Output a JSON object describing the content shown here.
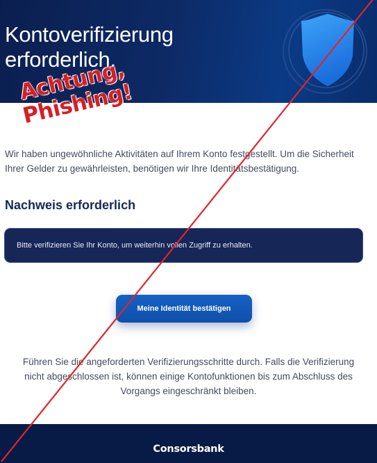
{
  "header": {
    "title_line1": "Kontoverifizierung",
    "title_line2": "erforderlich.",
    "icon": "shield-icon"
  },
  "warning_stamp": {
    "line1": "Achtung,",
    "line2": "Phishing!",
    "color": "#d51f26"
  },
  "intro": {
    "text": "Wir haben ungewöhnliche Aktivitäten auf Ihrem Konto festgestellt. Um die Sicherheit Ihrer Gelder zu gewährleisten, benötigen wir Ihre Identitätsbestätigung."
  },
  "section": {
    "title": "Nachweis erforderlich"
  },
  "notice": {
    "text": "Bitte verifizieren Sie Ihr Konto, um weiterhin vollen Zugriff zu erhalten."
  },
  "cta": {
    "label": "Meine Identität bestätigen",
    "color": "#1562c6"
  },
  "outro": {
    "line1": "Führen Sie die angeforderten Verifizierungsschritte durch. Falls die Verifizierung",
    "line2": "nicht abgeschlossen ist, können einige Kontofunktionen bis zum Abschluss des",
    "line3": "Vorgangs eingeschränkt bleiben."
  },
  "footer": {
    "brand": "Consorsbank"
  },
  "colors": {
    "header_bg": "#0d2a66",
    "footer_bg": "#071b46",
    "strike_line": "#e0242c"
  }
}
